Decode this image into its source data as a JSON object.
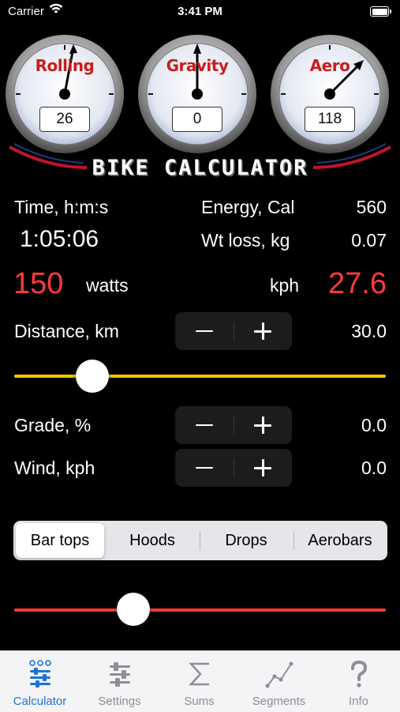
{
  "status_bar": {
    "carrier": "Carrier",
    "time": "3:41 PM"
  },
  "gauges": [
    {
      "label": "Rolling",
      "value": "26"
    },
    {
      "label": "Gravity",
      "value": "0"
    },
    {
      "label": "Aero",
      "value": "118"
    }
  ],
  "title": "BIKE CALCULATOR",
  "stats": {
    "time_label": "Time, h:m:s",
    "time_value": "1:05:06",
    "energy_label": "Energy, Cal",
    "energy_value": "560",
    "wt_loss_label": "Wt loss, kg",
    "wt_loss_value": "0.07",
    "power_value": "150",
    "power_unit": "watts",
    "speed_unit": "kph",
    "speed_value": "27.6"
  },
  "distance": {
    "label": "Distance, km",
    "value": "30.0",
    "slider_fraction": 0.21
  },
  "grade": {
    "label": "Grade, %",
    "value": "0.0"
  },
  "wind": {
    "label": "Wind, kph",
    "value": "0.0"
  },
  "position_segments": [
    "Bar tops",
    "Hoods",
    "Drops",
    "Aerobars"
  ],
  "selected_segment": "Bar tops",
  "bottom_slider_fraction": 0.32,
  "colors": {
    "accent_red": "#ff3b3b",
    "gauge_label_red": "#c81e1e",
    "distance_slider": "#f2c400",
    "bottom_slider": "#ff3b30",
    "tab_active": "#1a73d9",
    "tab_inactive": "#8e8e93"
  },
  "tabs": [
    {
      "label": "Calculator",
      "icon": "sliders-icon",
      "active": true
    },
    {
      "label": "Settings",
      "icon": "sliders-icon",
      "active": false
    },
    {
      "label": "Sums",
      "icon": "sigma-icon",
      "active": false
    },
    {
      "label": "Segments",
      "icon": "line-chart-icon",
      "active": false
    },
    {
      "label": "Info",
      "icon": "question-icon",
      "active": false
    }
  ]
}
